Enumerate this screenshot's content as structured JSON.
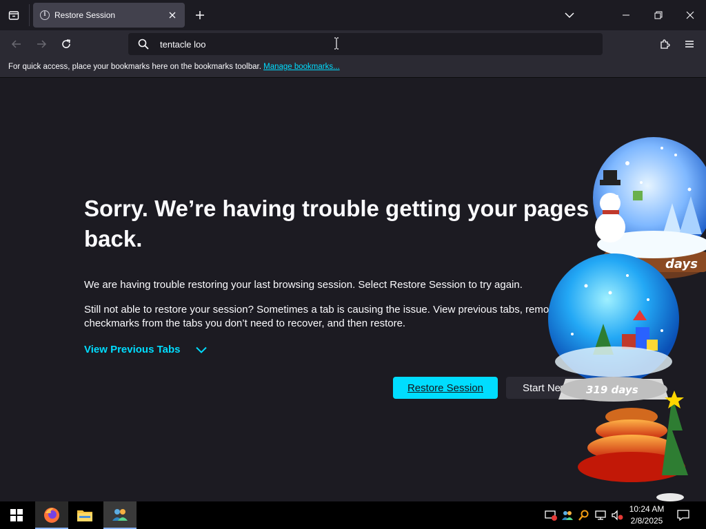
{
  "tab": {
    "title": "Restore Session"
  },
  "urlbar": {
    "value": "tentacle loo"
  },
  "bookmarks": {
    "message": "For quick access, place your bookmarks here on the bookmarks toolbar.",
    "link": "Manage bookmarks..."
  },
  "page": {
    "heading": "Sorry. We’re having trouble getting your pages back.",
    "para1": "We are having trouble restoring your last browsing session. Select Restore Session to try again.",
    "para2": "Still not able to restore your session? Sometimes a tab is causing the issue. View previous tabs, remove checkmarks from the tabs you don’t need to recover, and then restore.",
    "view_tabs": "View Previous Tabs",
    "restore_button": "Restore Session",
    "start_new_button": "Start New Session"
  },
  "gadget": {
    "days_top": "days",
    "days_bottom": "319 days"
  },
  "taskbar": {
    "time": "10:24 AM",
    "date": "2/8/2025"
  },
  "colors": {
    "accent": "#00ddff",
    "background": "#1c1b22",
    "toolbar": "#2b2a33"
  }
}
